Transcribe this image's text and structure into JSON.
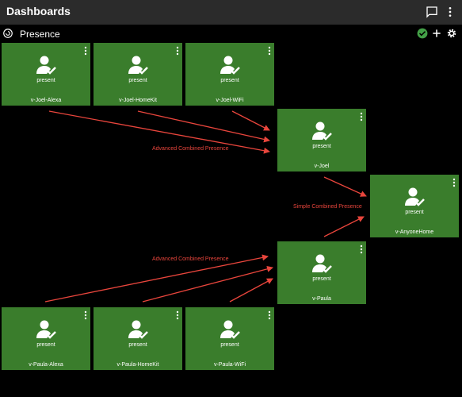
{
  "app": {
    "title": "Dashboards"
  },
  "dashboard": {
    "title": "Presence"
  },
  "icons": {
    "chat": "chat-icon",
    "more": "more-vertical-icon",
    "refresh": "refresh-icon",
    "status_ok": "check-circle-icon",
    "add": "plus-icon",
    "settings": "gear-icon",
    "presence": "person-check-icon"
  },
  "colors": {
    "tile": "#3a7d2c",
    "arrow": "#e8453c",
    "status_ok": "#43a047",
    "appbar": "#2b2b2b"
  },
  "tiles": [
    {
      "name": "v-Joel-Alexa",
      "state": "present"
    },
    {
      "name": "v-Joel-HomeKit",
      "state": "present"
    },
    {
      "name": "v-Joel-WiFi",
      "state": "present"
    },
    {
      "name": "v-Joel",
      "state": "present"
    },
    {
      "name": "v-AnyoneHome",
      "state": "present"
    },
    {
      "name": "v-Paula",
      "state": "present"
    },
    {
      "name": "v-Paula-Alexa",
      "state": "present"
    },
    {
      "name": "v-Paula-HomeKit",
      "state": "present"
    },
    {
      "name": "v-Paula-WiFi",
      "state": "present"
    }
  ],
  "annotations": {
    "joel_combined": "Advanced Combined Presence",
    "simple_combined": "Simple Combined Presence",
    "paula_combined": "Advanced Combined Presence"
  }
}
